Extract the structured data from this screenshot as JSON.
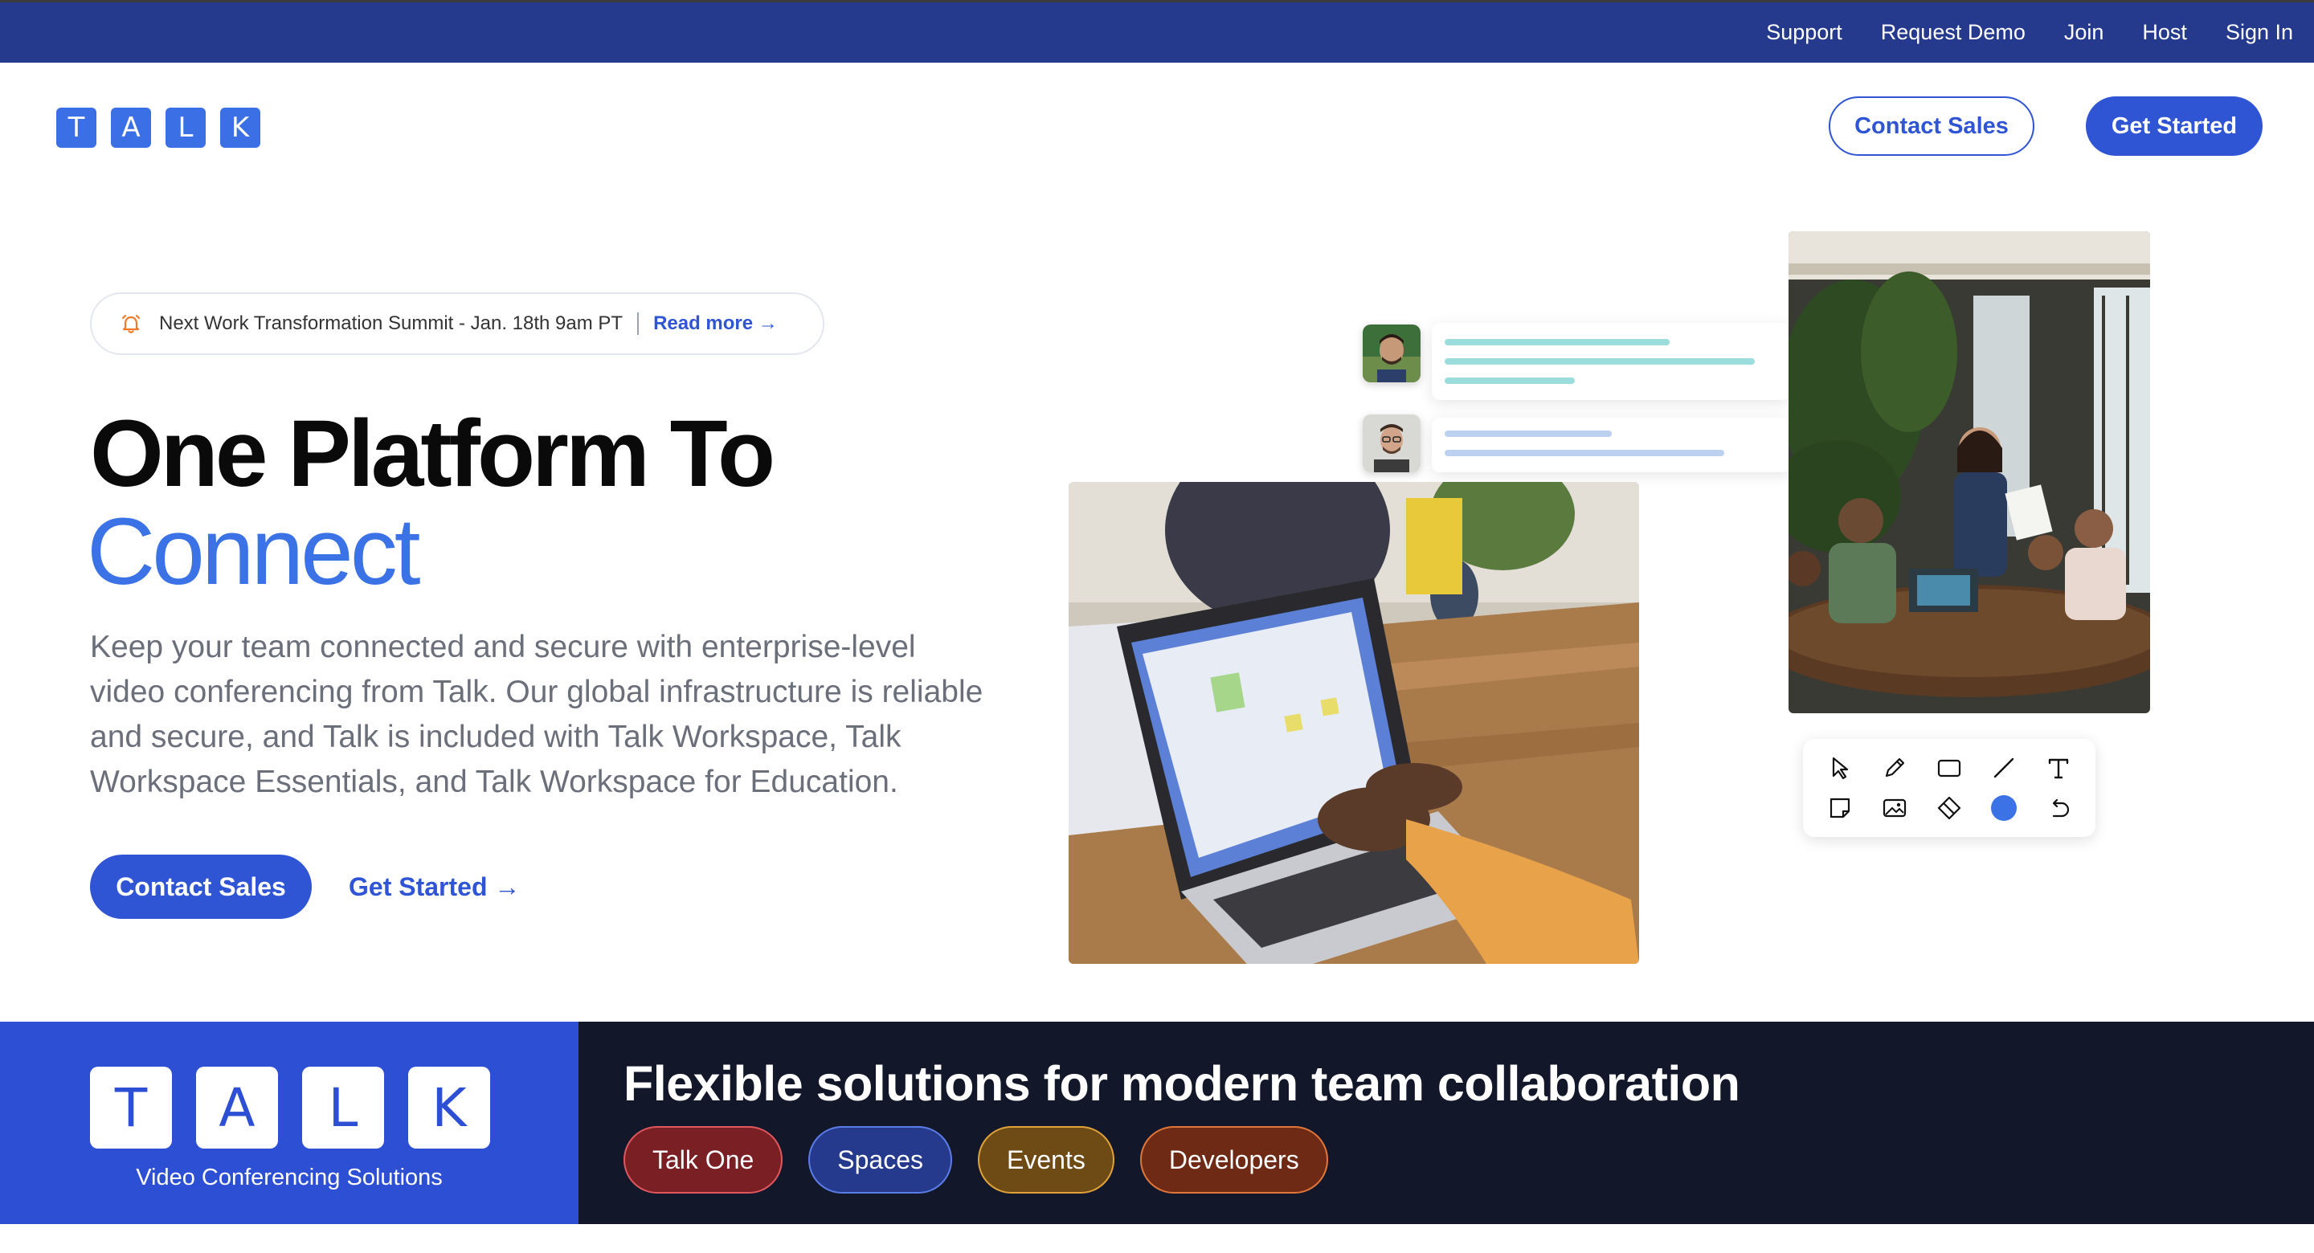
{
  "topnav": {
    "links": [
      "Support",
      "Request Demo",
      "Join",
      "Host",
      "Sign In"
    ]
  },
  "header": {
    "logo_letters": [
      "T",
      "A",
      "L",
      "K"
    ],
    "contact_sales": "Contact Sales",
    "get_started": "Get Started"
  },
  "hero": {
    "announcement": {
      "text": "Next Work Transformation Summit - Jan. 18th 9am PT",
      "link": "Read more →",
      "icon": "alarm-bell-icon"
    },
    "title_line1": "One Platform To",
    "title_line2": "Connect",
    "description": "Keep your team connected and secure with enterprise-level video conferencing from Talk. Our global infrastructure is reliable and secure, and Talk is included with Talk Workspace, Talk Workspace Essentials, and Talk Workspace for Education.",
    "cta_primary": "Contact Sales",
    "cta_secondary": "Get Started →"
  },
  "whiteboard_tools": [
    "pointer-icon",
    "pen-icon",
    "rectangle-icon",
    "line-icon",
    "text-icon",
    "sticky-note-icon",
    "image-icon",
    "eraser-icon",
    "color-dot-icon",
    "undo-icon"
  ],
  "band": {
    "logo_letters": [
      "T",
      "A",
      "L",
      "K"
    ],
    "tagline": "Video Conferencing Solutions",
    "title": "Flexible solutions for modern team collaboration",
    "pills": [
      {
        "label": "Talk One",
        "bg": "#7a1f24",
        "border": "#e0575d"
      },
      {
        "label": "Spaces",
        "bg": "#263a8d",
        "border": "#5b7de6"
      },
      {
        "label": "Events",
        "bg": "#6e4a14",
        "border": "#e0a33a"
      },
      {
        "label": "Developers",
        "bg": "#6e2a14",
        "border": "#e0763a"
      }
    ]
  },
  "colors": {
    "primary": "#2f55d4",
    "topbar": "#263a8d",
    "accent_blue": "#3b73e6",
    "dark_band": "#12172a"
  }
}
